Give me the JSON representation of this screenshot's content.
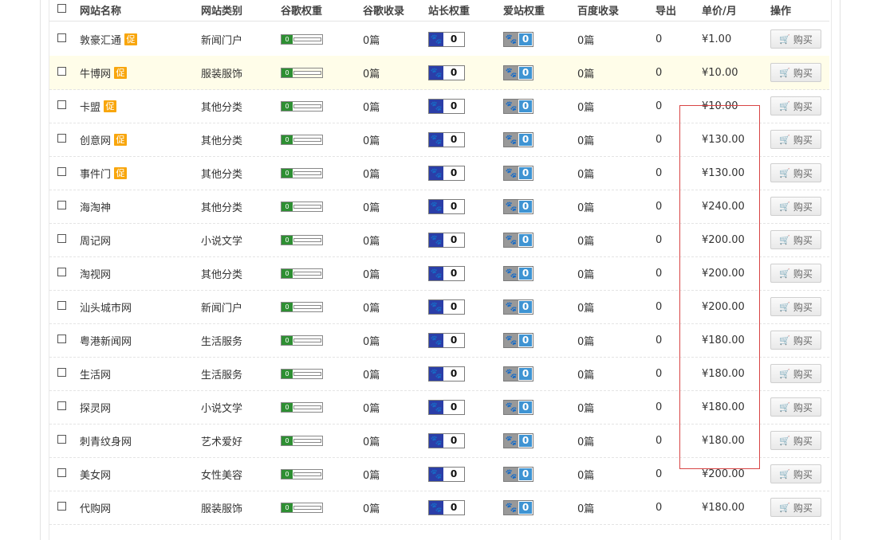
{
  "headers": {
    "name": "网站名称",
    "category": "网站类别",
    "google_pr": "谷歌权重",
    "google_index": "谷歌收录",
    "zz_weight": "站长权重",
    "az_weight": "爱站权重",
    "baidu_index": "百度收录",
    "export": "导出",
    "price": "单价/月",
    "action": "操作"
  },
  "promo_label": "促",
  "buy_label": "购买",
  "rows": [
    {
      "name": "敦豪汇通",
      "promo": true,
      "category": "新闻门户",
      "pr": "0",
      "google_index": "0篇",
      "zz": "0",
      "az": "0",
      "baidu_index": "0篇",
      "export": "0",
      "price": "¥1.00",
      "highlight": false
    },
    {
      "name": "牛博网",
      "promo": true,
      "category": "服装服饰",
      "pr": "0",
      "google_index": "0篇",
      "zz": "0",
      "az": "0",
      "baidu_index": "0篇",
      "export": "0",
      "price": "¥10.00",
      "highlight": true
    },
    {
      "name": "卡盟",
      "promo": true,
      "category": "其他分类",
      "pr": "0",
      "google_index": "0篇",
      "zz": "0",
      "az": "0",
      "baidu_index": "0篇",
      "export": "0",
      "price": "¥10.00",
      "highlight": false
    },
    {
      "name": "创意网",
      "promo": true,
      "category": "其他分类",
      "pr": "0",
      "google_index": "0篇",
      "zz": "0",
      "az": "0",
      "baidu_index": "0篇",
      "export": "0",
      "price": "¥130.00",
      "highlight": false
    },
    {
      "name": "事件门",
      "promo": true,
      "category": "其他分类",
      "pr": "0",
      "google_index": "0篇",
      "zz": "0",
      "az": "0",
      "baidu_index": "0篇",
      "export": "0",
      "price": "¥130.00",
      "highlight": false
    },
    {
      "name": "海淘神",
      "promo": false,
      "category": "其他分类",
      "pr": "0",
      "google_index": "0篇",
      "zz": "0",
      "az": "0",
      "baidu_index": "0篇",
      "export": "0",
      "price": "¥240.00",
      "highlight": false
    },
    {
      "name": "周记网",
      "promo": false,
      "category": "小说文学",
      "pr": "0",
      "google_index": "0篇",
      "zz": "0",
      "az": "0",
      "baidu_index": "0篇",
      "export": "0",
      "price": "¥200.00",
      "highlight": false
    },
    {
      "name": "淘视网",
      "promo": false,
      "category": "其他分类",
      "pr": "0",
      "google_index": "0篇",
      "zz": "0",
      "az": "0",
      "baidu_index": "0篇",
      "export": "0",
      "price": "¥200.00",
      "highlight": false
    },
    {
      "name": "汕头城市网",
      "promo": false,
      "category": "新闻门户",
      "pr": "0",
      "google_index": "0篇",
      "zz": "0",
      "az": "0",
      "baidu_index": "0篇",
      "export": "0",
      "price": "¥200.00",
      "highlight": false
    },
    {
      "name": "粤港新闻网",
      "promo": false,
      "category": "生活服务",
      "pr": "0",
      "google_index": "0篇",
      "zz": "0",
      "az": "0",
      "baidu_index": "0篇",
      "export": "0",
      "price": "¥180.00",
      "highlight": false
    },
    {
      "name": "生活网",
      "promo": false,
      "category": "生活服务",
      "pr": "0",
      "google_index": "0篇",
      "zz": "0",
      "az": "0",
      "baidu_index": "0篇",
      "export": "0",
      "price": "¥180.00",
      "highlight": false
    },
    {
      "name": "探灵网",
      "promo": false,
      "category": "小说文学",
      "pr": "0",
      "google_index": "0篇",
      "zz": "0",
      "az": "0",
      "baidu_index": "0篇",
      "export": "0",
      "price": "¥180.00",
      "highlight": false
    },
    {
      "name": "刺青纹身网",
      "promo": false,
      "category": "艺术爱好",
      "pr": "0",
      "google_index": "0篇",
      "zz": "0",
      "az": "0",
      "baidu_index": "0篇",
      "export": "0",
      "price": "¥180.00",
      "highlight": false
    },
    {
      "name": "美女网",
      "promo": false,
      "category": "女性美容",
      "pr": "0",
      "google_index": "0篇",
      "zz": "0",
      "az": "0",
      "baidu_index": "0篇",
      "export": "0",
      "price": "¥200.00",
      "highlight": false
    },
    {
      "name": "代购网",
      "promo": false,
      "category": "服装服饰",
      "pr": "0",
      "google_index": "0篇",
      "zz": "0",
      "az": "0",
      "baidu_index": "0篇",
      "export": "0",
      "price": "¥180.00",
      "highlight": false
    }
  ],
  "colors": {
    "promo_badge": "#f8a60d",
    "highlight_row": "#fffde9",
    "annotation_box": "#d84545",
    "zz_icon": "#2b3ea8",
    "az_number": "#3f94d3",
    "pr_green": "#2e8f33"
  }
}
